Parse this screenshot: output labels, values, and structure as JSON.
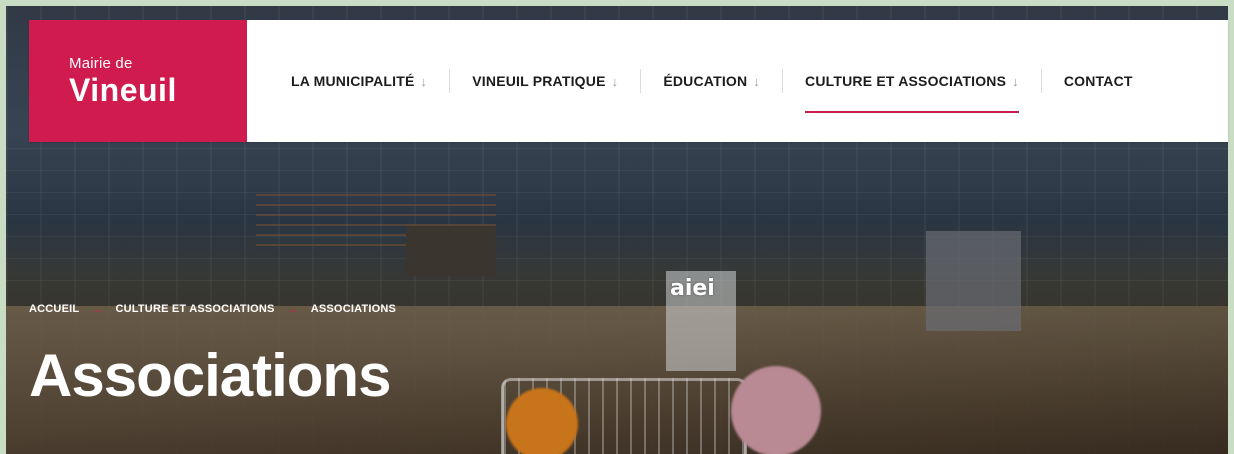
{
  "logo": {
    "line1": "Mairie de",
    "line2": "Vineuil",
    "brand_color": "#cf1b4e"
  },
  "nav": {
    "items": [
      {
        "label": "LA MUNICIPALITÉ",
        "arrow": "↓"
      },
      {
        "label": "VINEUIL PRATIQUE",
        "arrow": "↓"
      },
      {
        "label": "ÉDUCATION",
        "arrow": "↓"
      },
      {
        "label": "CULTURE ET ASSOCIATIONS",
        "arrow": "↓",
        "active": true
      },
      {
        "label": "CONTACT",
        "arrow": ""
      }
    ]
  },
  "breadcrumb": {
    "items": [
      "ACCUEIL",
      "CULTURE ET ASSOCIATIONS",
      "ASSOCIATIONS"
    ],
    "separator": "→"
  },
  "page": {
    "title": "Associations"
  },
  "hero": {
    "sign_text": "aiei"
  }
}
